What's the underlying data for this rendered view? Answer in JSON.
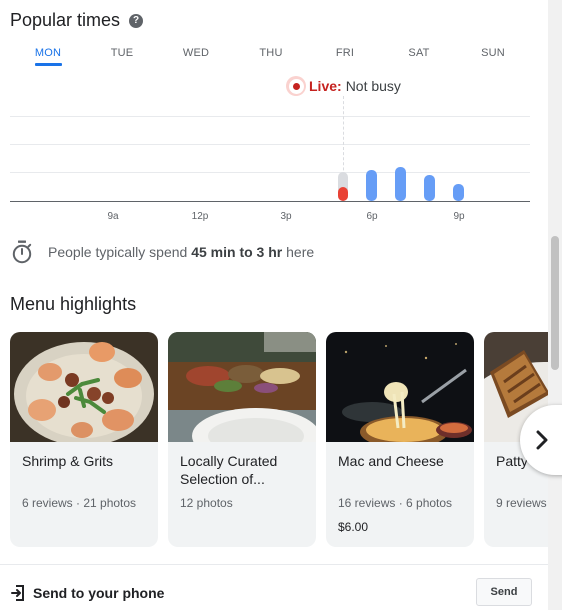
{
  "popular_times": {
    "title": "Popular times",
    "help_icon": "?",
    "days": [
      "MON",
      "TUE",
      "WED",
      "THU",
      "FRI",
      "SAT",
      "SUN"
    ],
    "selected_day": "MON",
    "live": {
      "label": "Live:",
      "status": "Not busy"
    },
    "x_ticks": [
      "9a",
      "12p",
      "3p",
      "6p",
      "9p"
    ],
    "colors": {
      "usual": "#669df6",
      "live": "#e94235",
      "live_usual": "#dadce0",
      "accent": "#1a73e8"
    }
  },
  "chart_data": {
    "type": "bar",
    "title": "",
    "xlabel": "",
    "ylabel": "",
    "categories": [
      "5p",
      "6p",
      "7p",
      "8p",
      "9p"
    ],
    "series": [
      {
        "values": [
          0.6,
          0.65,
          0.7,
          0.55,
          0.35
        ]
      }
    ],
    "live_value": 0.3,
    "live_hour": "5p",
    "ylim": [
      0,
      1
    ],
    "grid": true
  },
  "visit_duration": {
    "prefix": "People typically spend",
    "value": "45 min to 3 hr",
    "suffix": "here",
    "icon": "timer-icon"
  },
  "menu": {
    "title": "Menu highlights",
    "items": [
      {
        "name": "Shrimp & Grits",
        "meta": "6 reviews · 21 photos",
        "price": ""
      },
      {
        "name": "Locally Curated Selection of...",
        "meta": "12 photos",
        "price": ""
      },
      {
        "name": "Mac and Cheese",
        "meta": "16 reviews · 6 photos",
        "price": "$6.00"
      },
      {
        "name": "Patty",
        "meta": "9 reviews",
        "price": ""
      }
    ],
    "next_icon": "chevron-right-icon"
  },
  "send": {
    "label": "Send to your phone",
    "button": "Send",
    "icon": "send-to-phone-icon"
  }
}
